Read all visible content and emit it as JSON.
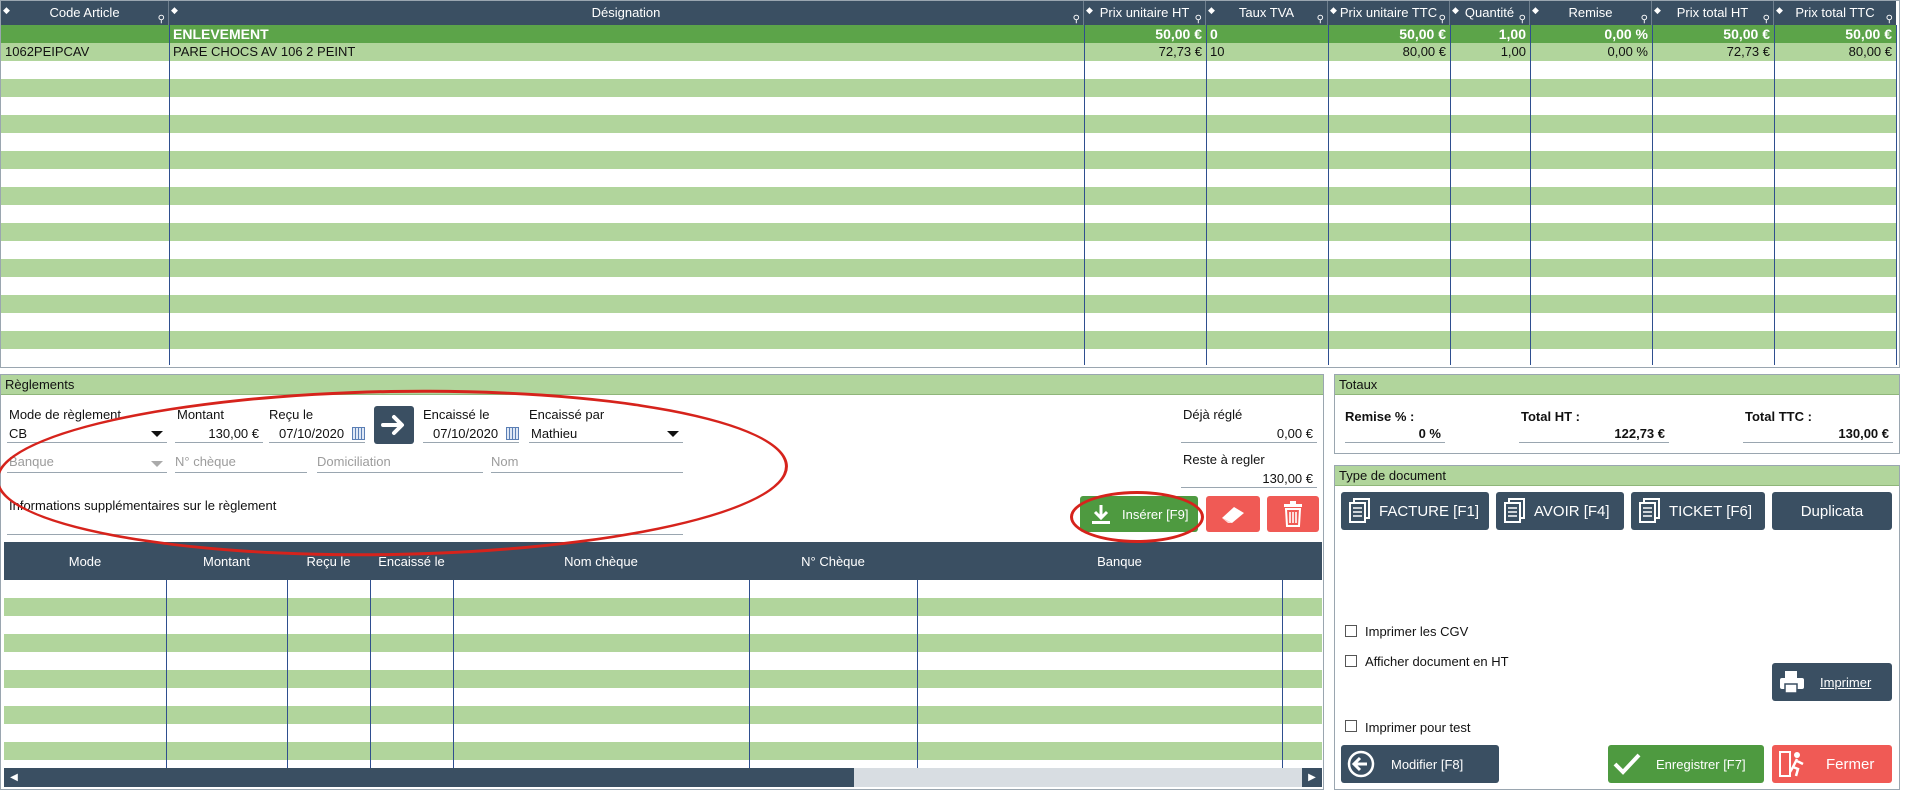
{
  "top_grid": {
    "columns": [
      "Code Article",
      "Désignation",
      "Prix unitaire HT",
      "Taux TVA",
      "Prix unitaire TTC",
      "Quantité",
      "Remise",
      "Prix total HT",
      "Prix total TTC"
    ],
    "group_row": {
      "designation": "ENLEVEMENT",
      "pu_ht": "50,00 €",
      "tva": "0",
      "pu_ttc": "50,00 €",
      "qty": "1,00",
      "remise": "0,00 %",
      "total_ht": "50,00 €",
      "total_ttc": "50,00 €"
    },
    "item_row": {
      "code": "1062PEIPCAV",
      "designation": "PARE CHOCS AV 106 2 PEINT",
      "pu_ht": "72,73 €",
      "tva": "10",
      "pu_ttc": "80,00 €",
      "qty": "1,00",
      "remise": "0,00 %",
      "total_ht": "72,73 €",
      "total_ttc": "80,00 €"
    }
  },
  "reglements": {
    "title": "Règlements",
    "mode_label": "Mode de règlement",
    "mode_value": "CB",
    "montant_label": "Montant",
    "montant_value": "130,00 €",
    "recu_label": "Reçu le",
    "recu_value": "07/10/2020",
    "encaisse_label": "Encaissé le",
    "encaisse_value": "07/10/2020",
    "encaisse_par_label": "Encaissé par",
    "encaisse_par_value": "Mathieu",
    "banque_label": "Banque",
    "cheque_label": "N° chèque",
    "domiciliation_label": "Domiciliation",
    "nom_label": "Nom",
    "infos_label": "Informations supplémentaires sur le règlement",
    "deja_regle_label": "Déjà réglé",
    "deja_regle_value": "0,00 €",
    "reste_label": "Reste à regler",
    "reste_value": "130,00 €",
    "insert_button": "Insérer [F9]",
    "pay_columns": [
      "Mode",
      "Montant",
      "Reçu le",
      "Encaissé le",
      "Nom chèque",
      "N° Chèque",
      "Banque"
    ]
  },
  "totaux": {
    "title": "Totaux",
    "remise_label": "Remise % :",
    "remise_value": "0 %",
    "total_ht_label": "Total HT :",
    "total_ht_value": "122,73 €",
    "total_ttc_label": "Total TTC :",
    "total_ttc_value": "130,00 €"
  },
  "typedoc": {
    "title": "Type de document",
    "facture": "FACTURE [F1]",
    "avoir": "AVOIR [F4]",
    "ticket": "TICKET [F6]",
    "duplicata": "Duplicata",
    "cgv": "Imprimer les CGV",
    "afficher_ht": "Afficher document en HT",
    "imprimer": "Imprimer",
    "imprimer_test": "Imprimer pour test",
    "modifier": "Modifier [F8]",
    "enregistrer": "Enregistrer [F7]",
    "fermer": "Fermer"
  },
  "colors": {
    "header": "#3a4f62",
    "row_green": "#b1d59c",
    "group_green": "#5ca449",
    "button_green": "#4e9a40",
    "button_red": "#f05a55",
    "highlight": "#d6231c"
  }
}
